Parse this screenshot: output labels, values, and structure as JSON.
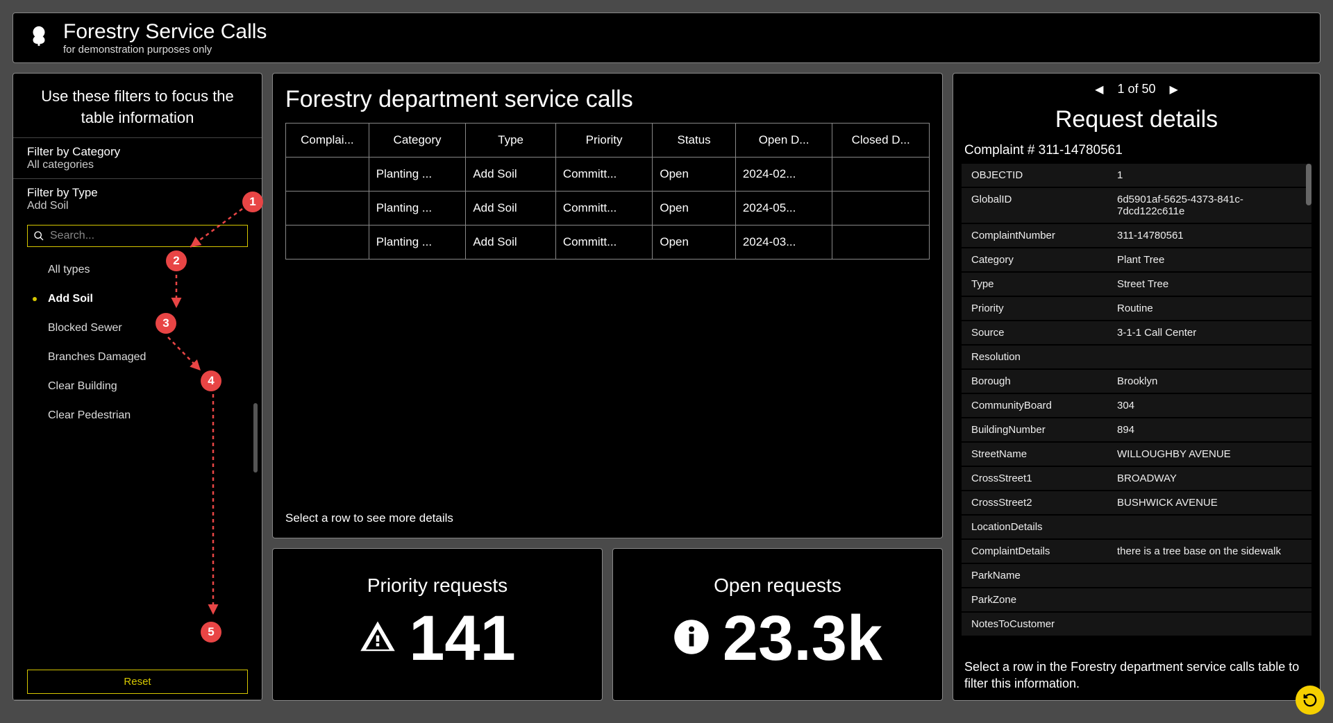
{
  "header": {
    "title": "Forestry Service Calls",
    "subtitle": "for demonstration purposes only"
  },
  "sidebar": {
    "intro": "Use these filters to focus the table information",
    "category_label": "Filter by Category",
    "category_value": "All categories",
    "type_label": "Filter by Type",
    "type_value": "Add Soil",
    "search_placeholder": "Search...",
    "types": [
      "All types",
      "Add Soil",
      "Blocked Sewer",
      "Branches Damaged",
      "Clear Building",
      "Clear Pedestrian"
    ],
    "selected_type_index": 1,
    "reset": "Reset"
  },
  "badges": [
    "1",
    "2",
    "3",
    "4",
    "5"
  ],
  "table": {
    "title": "Forestry department service calls",
    "columns": [
      "Complai...",
      "Category",
      "Type",
      "Priority",
      "Status",
      "Open D...",
      "Closed D..."
    ],
    "rows": [
      [
        "",
        "Planting ...",
        "Add Soil",
        "Committ...",
        "Open",
        "2024-02...",
        ""
      ],
      [
        "",
        "Planting ...",
        "Add Soil",
        "Committ...",
        "Open",
        "2024-05...",
        ""
      ],
      [
        "",
        "Planting ...",
        "Add Soil",
        "Committ...",
        "Open",
        "2024-03...",
        ""
      ]
    ],
    "hint": "Select a row to see more details"
  },
  "stats": {
    "priority_label": "Priority requests",
    "priority_value": "141",
    "open_label": "Open requests",
    "open_value": "23.3k"
  },
  "details": {
    "pager": "1 of 50",
    "title": "Request details",
    "complaint_label": "Complaint # 311-14780561",
    "rows": [
      [
        "OBJECTID",
        "1"
      ],
      [
        "GlobalID",
        "6d5901af-5625-4373-841c-7dcd122c611e"
      ],
      [
        "ComplaintNumber",
        "311-14780561"
      ],
      [
        "Category",
        "Plant Tree"
      ],
      [
        "Type",
        "Street Tree"
      ],
      [
        "Priority",
        "Routine"
      ],
      [
        "Source",
        "3-1-1 Call Center"
      ],
      [
        "Resolution",
        ""
      ],
      [
        "Borough",
        "Brooklyn"
      ],
      [
        "CommunityBoard",
        "304"
      ],
      [
        "BuildingNumber",
        "894"
      ],
      [
        "StreetName",
        "WILLOUGHBY AVENUE"
      ],
      [
        "CrossStreet1",
        "BROADWAY"
      ],
      [
        "CrossStreet2",
        "BUSHWICK AVENUE"
      ],
      [
        "LocationDetails",
        ""
      ],
      [
        "ComplaintDetails",
        "there is a tree base on the sidewalk"
      ],
      [
        "ParkName",
        ""
      ],
      [
        "ParkZone",
        ""
      ],
      [
        "NotesToCustomer",
        ""
      ]
    ],
    "hint": "Select a row in the Forestry department service calls table to filter this information."
  }
}
